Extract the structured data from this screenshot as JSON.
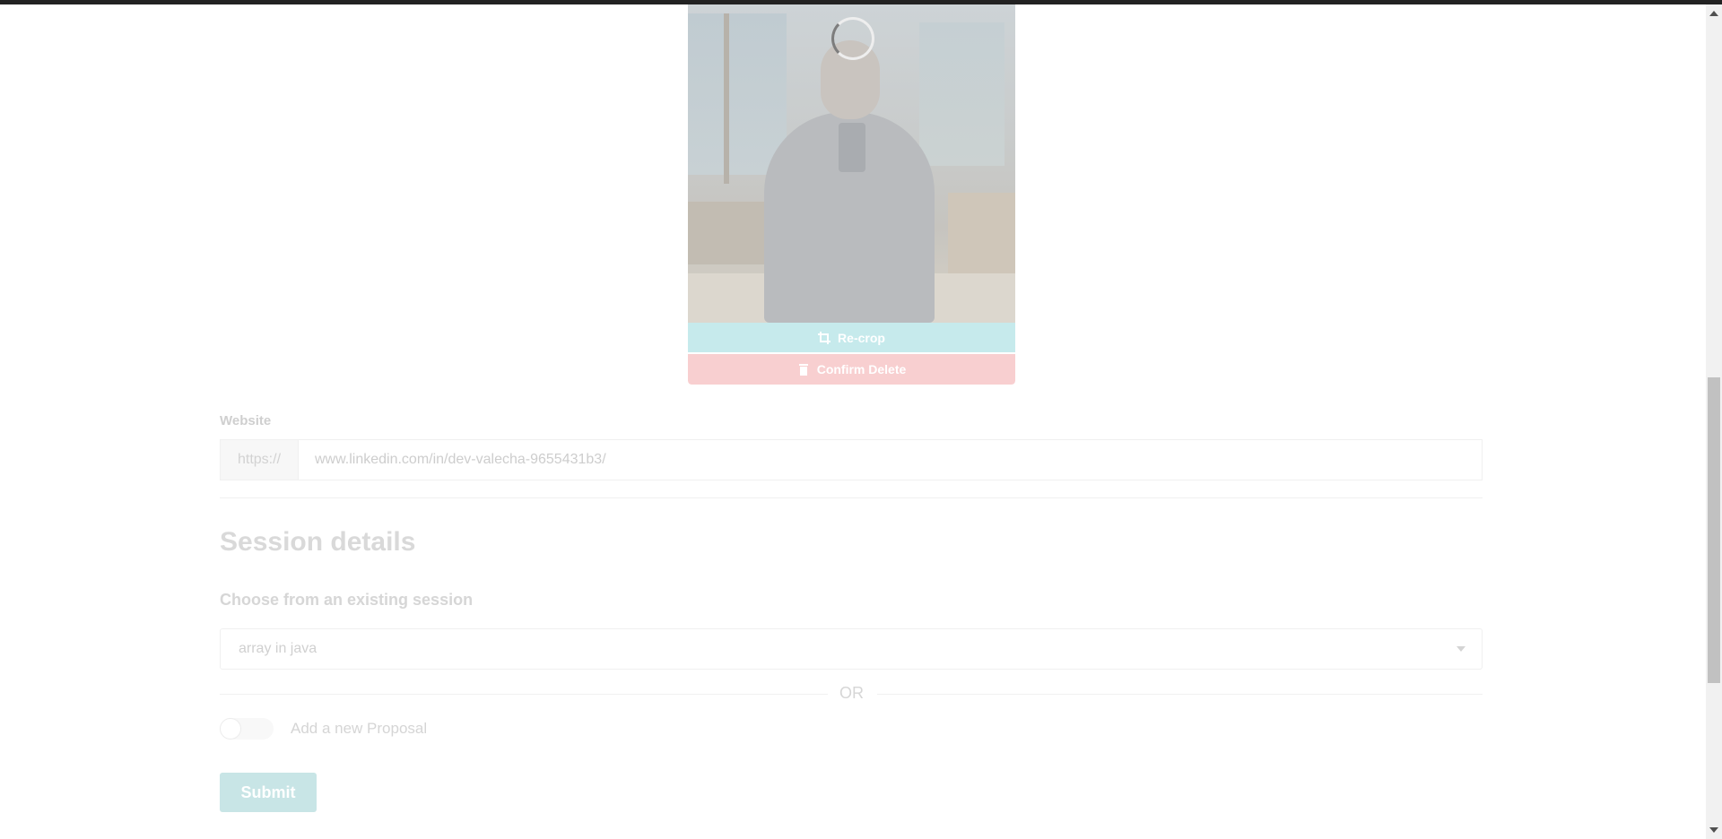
{
  "photo": {
    "recrop_label": "Re-crop",
    "delete_label": "Confirm Delete"
  },
  "website": {
    "label": "Website",
    "prefix": "https://",
    "value": "www.linkedin.com/in/dev-valecha-9655431b3/"
  },
  "session": {
    "title": "Session details",
    "choose_label": "Choose from an existing session",
    "selected": "array in java",
    "or_text": "OR",
    "proposal_label": "Add a new Proposal",
    "proposal_toggle_on": false
  },
  "submit_label": "Submit",
  "colors": {
    "recrop": "#c6eaec",
    "delete": "#f8cfd0",
    "submit": "#c8e5e6"
  }
}
